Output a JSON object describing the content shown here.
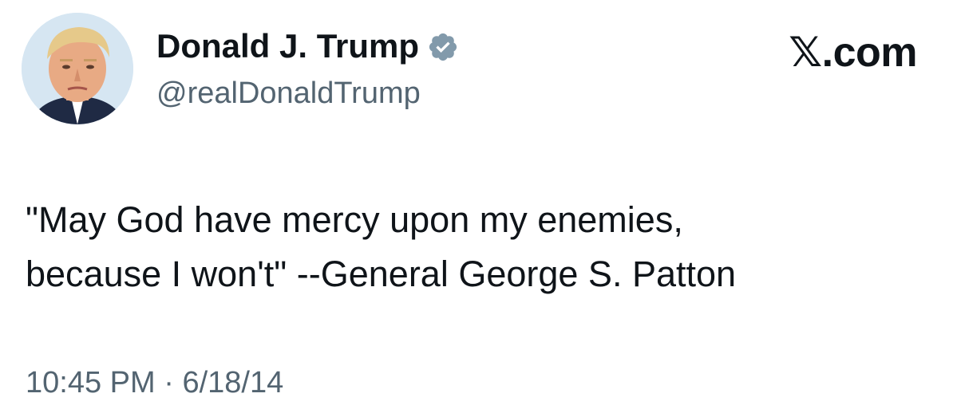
{
  "author": {
    "display_name": "Donald J. Trump",
    "handle": "@realDonaldTrump",
    "verified": true,
    "verified_color": "#829aab"
  },
  "brand": {
    "logo_text": "𝕏.com"
  },
  "tweet": {
    "text_lines": [
      "\"May God have mercy upon my enemies,",
      "because I won't\" --General George S. Patton"
    ],
    "time": "10:45 PM",
    "separator": "·",
    "date": "6/18/14"
  },
  "colors": {
    "text_primary": "#0f1419",
    "text_secondary": "#536471",
    "background": "#ffffff"
  }
}
